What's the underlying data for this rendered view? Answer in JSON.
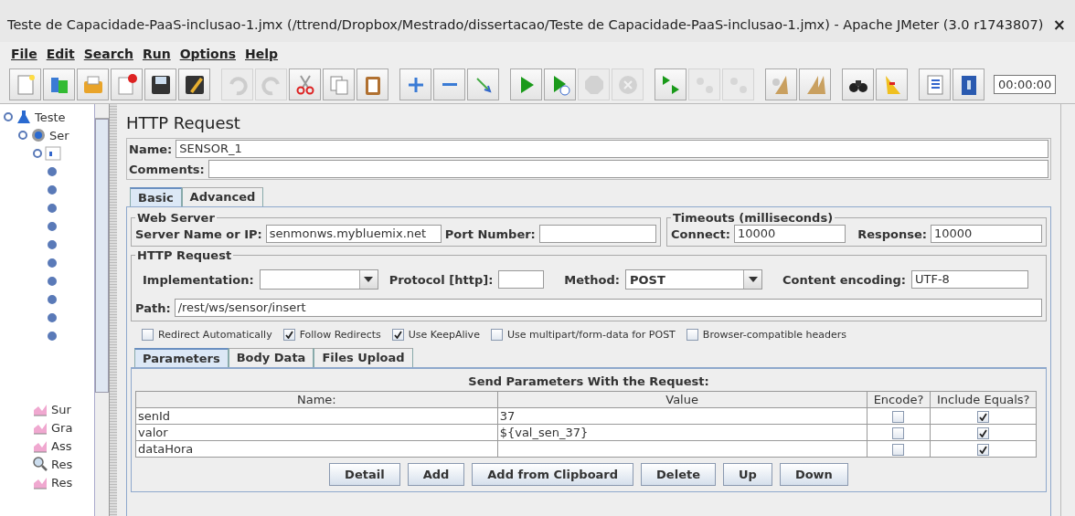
{
  "window": {
    "title": "Teste de Capacidade-PaaS-inclusao-1.jmx (/ttrend/Dropbox/Mestrado/dissertacao/Teste de Capacidade-PaaS-inclusao-1.jmx) - Apache JMeter (3.0 r1743807)",
    "close": "×"
  },
  "menu": [
    {
      "label": "File",
      "selected": false
    },
    {
      "label": "Edit",
      "selected": false
    },
    {
      "label": "Search",
      "selected": false
    },
    {
      "label": "Run",
      "selected": false
    },
    {
      "label": "Options",
      "selected": false
    },
    {
      "label": "Help",
      "selected": false
    }
  ],
  "toolbar": [
    [
      {
        "kind": "new",
        "disabled": false
      },
      {
        "kind": "templates",
        "disabled": false
      },
      {
        "kind": "open",
        "disabled": false
      },
      {
        "kind": "close",
        "disabled": false
      },
      {
        "kind": "save",
        "disabled": false
      },
      {
        "kind": "saveas",
        "disabled": false
      }
    ],
    [
      {
        "kind": "undo",
        "disabled": true
      },
      {
        "kind": "redo",
        "disabled": true
      },
      {
        "kind": "cut",
        "disabled": false
      },
      {
        "kind": "copy",
        "disabled": false
      },
      {
        "kind": "paste",
        "disabled": false
      }
    ],
    [
      {
        "kind": "expand",
        "disabled": false
      },
      {
        "kind": "collapse",
        "disabled": false
      },
      {
        "kind": "toggle",
        "disabled": false
      }
    ],
    [
      {
        "kind": "start",
        "disabled": false
      },
      {
        "kind": "startnopause",
        "disabled": false
      },
      {
        "kind": "stop",
        "disabled": true
      },
      {
        "kind": "shutdown",
        "disabled": true
      }
    ],
    [
      {
        "kind": "remotestart",
        "disabled": false
      },
      {
        "kind": "remotestop",
        "disabled": true
      },
      {
        "kind": "remoteexit",
        "disabled": true
      }
    ],
    [
      {
        "kind": "clear",
        "disabled": false
      },
      {
        "kind": "clearall",
        "disabled": false
      }
    ],
    [
      {
        "kind": "search",
        "disabled": false
      },
      {
        "kind": "reset",
        "disabled": false
      }
    ],
    [
      {
        "kind": "functions",
        "disabled": false
      },
      {
        "kind": "help",
        "disabled": false
      }
    ]
  ],
  "timer": "00:00:00",
  "tree": {
    "label": "Teste",
    "kind": "plan",
    "expanded": true,
    "children": [
      {
        "label": "Ser",
        "kind": "group",
        "expanded": true,
        "children": [
          {
            "kind": "controller",
            "expanded": true,
            "children": [
              {
                "kind": "leaf"
              },
              {
                "kind": "leaf"
              },
              {
                "kind": "leaf"
              },
              {
                "kind": "leaf"
              },
              {
                "kind": "leaf"
              },
              {
                "kind": "leaf"
              },
              {
                "kind": "leaf"
              },
              {
                "kind": "leaf"
              },
              {
                "kind": "leaf"
              },
              {
                "kind": "leaf"
              },
              {
                "kind": "stub"
              },
              {
                "kind": "stub"
              },
              {
                "kind": "stub"
              }
            ]
          }
        ]
      },
      {
        "label": "Sur",
        "kind": "chart"
      },
      {
        "label": "Gra",
        "kind": "chart"
      },
      {
        "label": "Ass",
        "kind": "chart"
      },
      {
        "label": "Res",
        "kind": "search"
      },
      {
        "label": "Res",
        "kind": "chart"
      }
    ]
  },
  "panel": {
    "title": "HTTP Request",
    "name_label": "Name:",
    "name": "SENSOR_1",
    "comments_label": "Comments:",
    "tabs": [
      {
        "label": "Basic",
        "selected": true
      },
      {
        "label": "Advanced",
        "selected": false
      }
    ],
    "web_server": {
      "title": "Web Server",
      "server_label": "Server Name or IP:",
      "server": "senmonws.mybluemix.net",
      "port_label": "Port Number:"
    },
    "timeouts": {
      "title": "Timeouts (milliseconds)",
      "connect_label": "Connect:",
      "connect": "10000",
      "response_label": "Response:",
      "response": "10000"
    },
    "http": {
      "title": "HTTP Request",
      "implementation_label": "Implementation:",
      "protocol_label": "Protocol [http]:",
      "method_label": "Method:",
      "method": "POST",
      "encoding_label": "Content encoding:",
      "encoding": "UTF-8",
      "path_label": "Path:",
      "path": "/rest/ws/sensor/insert"
    },
    "options": [
      {
        "label": "Redirect Automatically",
        "checked": false
      },
      {
        "label": "Follow Redirects",
        "checked": true
      },
      {
        "label": "Use KeepAlive",
        "checked": true
      },
      {
        "label": "Use multipart/form-data for POST",
        "checked": false
      },
      {
        "label": "Browser-compatible headers",
        "checked": false
      }
    ],
    "subtabs": [
      {
        "label": "Parameters",
        "selected": true
      },
      {
        "label": "Body Data",
        "selected": false
      },
      {
        "label": "Files Upload",
        "selected": false
      }
    ],
    "params": {
      "caption": "Send Parameters With the Request:",
      "columns": [
        "Name:",
        "Value",
        "Encode?",
        "Include Equals?"
      ],
      "rows": [
        {
          "name": "senId",
          "value": "37",
          "encode": false,
          "include_equals": true
        },
        {
          "name": "valor",
          "value": "${val_sen_37}",
          "encode": false,
          "include_equals": true
        },
        {
          "name": "dataHora",
          "value": "",
          "encode": false,
          "include_equals": true
        }
      ]
    },
    "buttons": [
      "Detail",
      "Add",
      "Add from Clipboard",
      "Delete",
      "Up",
      "Down"
    ]
  }
}
